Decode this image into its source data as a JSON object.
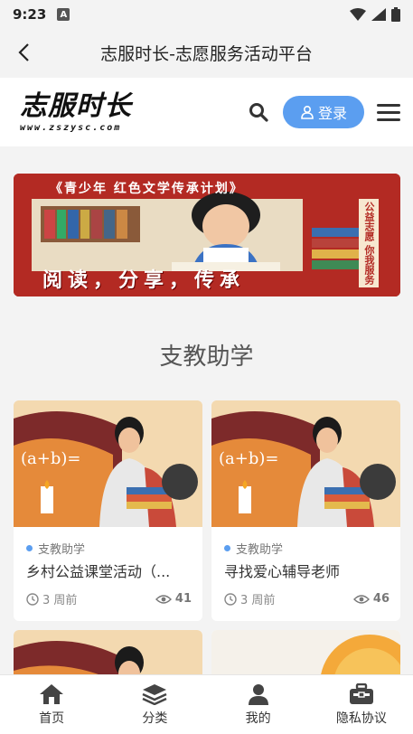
{
  "statusbar": {
    "time": "9:23",
    "badge": "A"
  },
  "titlebar": {
    "title": "志服时长-志愿服务活动平台"
  },
  "header": {
    "logo_main": "志服时长",
    "logo_url": "www.zszysc.com",
    "login_label": "登录"
  },
  "banner": {
    "top_text": "《青少年 红色文学传承计划》",
    "side_text": "公益志愿 你我服务",
    "bottom_text": "阅读，分享，传承"
  },
  "section": {
    "title": "支教助学"
  },
  "cards": [
    {
      "category": "支教助学",
      "title": "乡村公益课堂活动（...",
      "time": "3 周前",
      "views": "41"
    },
    {
      "category": "支教助学",
      "title": "寻找爱心辅导老师",
      "time": "3 周前",
      "views": "46"
    }
  ],
  "tabbar": {
    "items": [
      {
        "label": "首页",
        "icon": "home-icon"
      },
      {
        "label": "分类",
        "icon": "layers-icon"
      },
      {
        "label": "我的",
        "icon": "user-icon"
      },
      {
        "label": "隐私协议",
        "icon": "briefcase-icon"
      }
    ]
  },
  "colors": {
    "accent": "#5b9ef0",
    "banner_red": "#b32a23"
  }
}
